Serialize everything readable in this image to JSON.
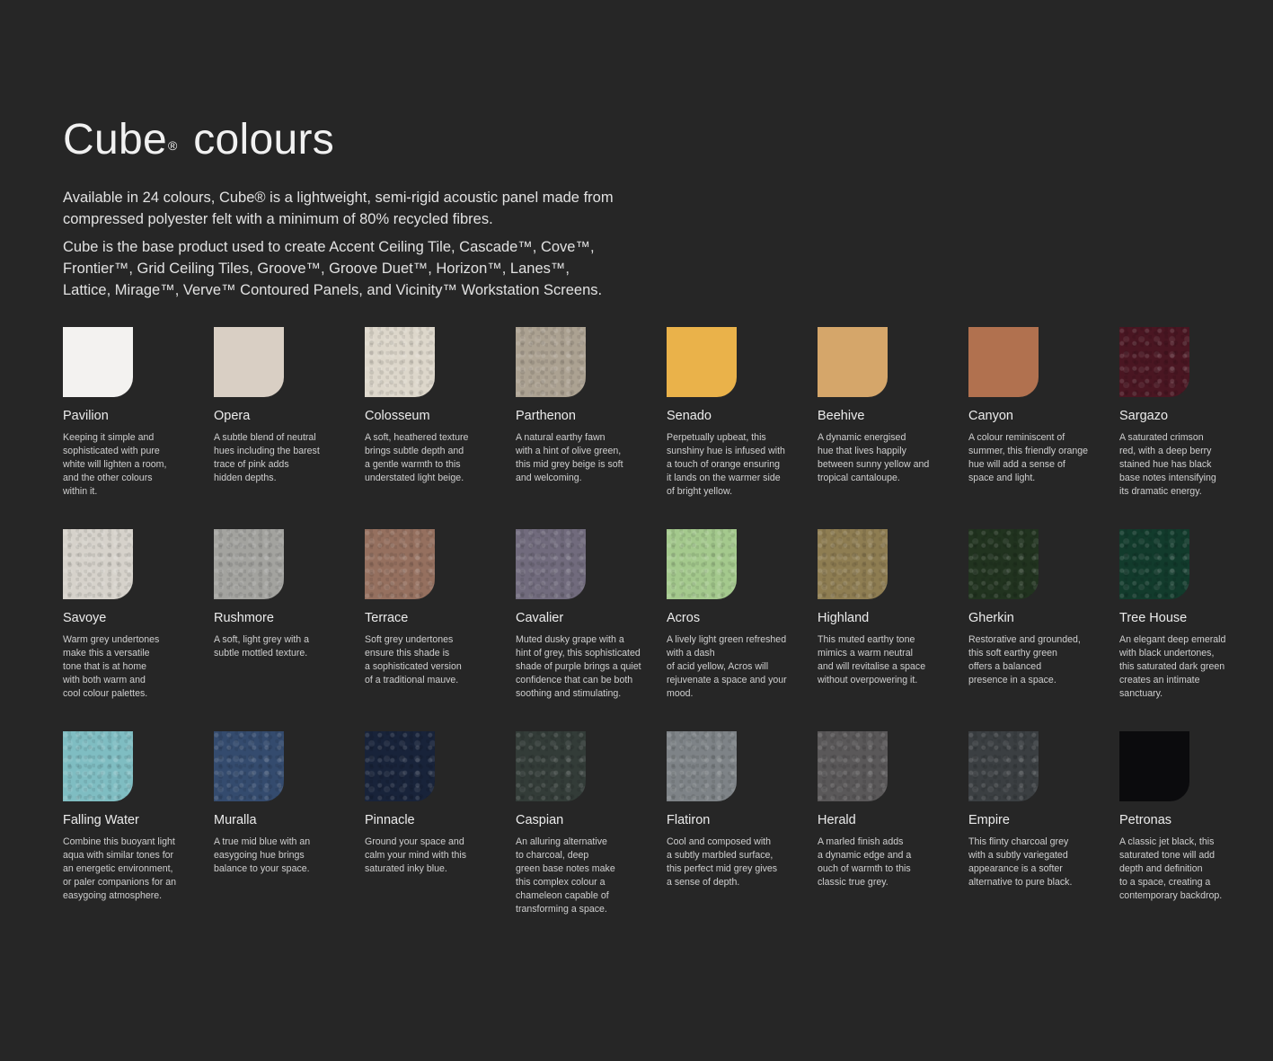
{
  "header": {
    "title_main": "Cube",
    "title_sup": "®",
    "title_rest": " colours"
  },
  "intro": {
    "paragraph_1": "Available in 24 colours, Cube® is a lightweight, semi-rigid acoustic panel made from compressed polyester felt with a minimum of 80% recycled fibres.",
    "paragraph_2": "Cube is the base product used to create Accent Ceiling Tile, Cascade™, Cove™, Frontier™, Grid Ceiling Tiles, Groove™, Groove Duet™, Horizon™, Lanes™, Lattice, Mirage™, Verve™ Contoured Panels, and Vicinity™ Workstation Screens."
  },
  "colours": [
    {
      "name": "Pavilion",
      "color": "#f3f2f0",
      "description": "Keeping it simple and\nsophisticated with pure\nwhite will lighten a room,\nand the other colours\nwithin it."
    },
    {
      "name": "Opera",
      "color": "#d9cfc4",
      "description": "A subtle blend of neutral\nhues including the barest\ntrace of pink adds\nhidden depths."
    },
    {
      "name": "Colosseum",
      "color": "#ddd7cb",
      "description": "A soft, heathered texture\nbrings subtle depth and\na gentle warmth to this\nunderstated light beige."
    },
    {
      "name": "Parthenon",
      "color": "#aca292",
      "description": "A natural earthy fawn\nwith a hint of olive green,\nthis mid grey beige is soft\nand welcoming."
    },
    {
      "name": "Senado",
      "color": "#eab24a",
      "description": "Perpetually upbeat, this\nsunshiny hue is infused with\na touch of orange ensuring\nit lands on the warmer side\nof bright yellow."
    },
    {
      "name": "Beehive",
      "color": "#d5a66a",
      "description": "A dynamic energised\nhue that lives happily\nbetween sunny yellow and\ntropical cantaloupe."
    },
    {
      "name": "Canyon",
      "color": "#b1714f",
      "description": "A colour reminiscent of\nsummer, this friendly orange\nhue will add a sense of\nspace and light."
    },
    {
      "name": "Sargazo",
      "color": "#4a1622",
      "description": "A saturated crimson\nred, with a deep berry\nstained hue has black\nbase notes intensifying\nits dramatic energy."
    },
    {
      "name": "Savoye",
      "color": "#d6d2cb",
      "description": "Warm grey undertones\nmake this a versatile\ntone that is at home\nwith both warm and\ncool colour palettes."
    },
    {
      "name": "Rushmore",
      "color": "#a3a39f",
      "description": "A soft, light grey with a\nsubtle mottled texture."
    },
    {
      "name": "Terrace",
      "color": "#95705f",
      "description": "Soft grey undertones\nensure this shade is\na sophisticated version\nof a traditional mauve."
    },
    {
      "name": "Cavalier",
      "color": "#716b7d",
      "description": "Muted dusky grape with a\nhint of grey, this sophisticated\nshade of purple brings a quiet\nconfidence that can be both\nsoothing and stimulating."
    },
    {
      "name": "Acros",
      "color": "#a4c98d",
      "description": "A lively light green refreshed\nwith a dash\nof acid yellow, Acros will\nrejuvenate a space and your\nmood."
    },
    {
      "name": "Highland",
      "color": "#8e7d52",
      "description": "This muted earthy tone\nmimics a warm neutral\nand will revitalise a space\nwithout overpowering it."
    },
    {
      "name": "Gherkin",
      "color": "#21331f",
      "description": "Restorative and grounded,\nthis soft earthy green\noffers a balanced\npresence in a space."
    },
    {
      "name": "Tree House",
      "color": "#123b2c",
      "description": "An elegant deep emerald\nwith black undertones,\nthis saturated dark green\ncreates an intimate\nsanctuary."
    },
    {
      "name": "Falling Water",
      "color": "#7fbdc2",
      "description": "Combine this buoyant light\naqua with similar tones for\nan energetic environment,\nor paler companions for an\neasygoing atmosphere."
    },
    {
      "name": "Muralla",
      "color": "#344b6e",
      "description": "A true mid blue with an\neasygoing hue brings\nbalance to your space."
    },
    {
      "name": "Pinnacle",
      "color": "#18233a",
      "description": "Ground your space and\ncalm your mind with this\nsaturated inky blue."
    },
    {
      "name": "Caspian",
      "color": "#333c38",
      "description": "An alluring alternative\nto charcoal, deep\ngreen base notes make\nthis complex colour a\nchameleon capable of\ntransforming a space."
    },
    {
      "name": "Flatiron",
      "color": "#7e8387",
      "description": "Cool and composed with\na subtly marbled surface,\nthis perfect mid grey gives\na sense of depth."
    },
    {
      "name": "Herald",
      "color": "#5a5859",
      "description": "A marled finish adds\na dynamic edge and a\nouch of warmth to this\nclassic true grey."
    },
    {
      "name": "Empire",
      "color": "#3b3f42",
      "description": "This flinty charcoal grey\nwith a subtly variegated\nappearance is a softer\nalternative to pure black."
    },
    {
      "name": "Petronas",
      "color": "#0b0b0d",
      "description": "A classic jet black, this\nsaturated tone will add\ndepth and definition\nto a space, creating a\ncontemporary backdrop."
    }
  ]
}
